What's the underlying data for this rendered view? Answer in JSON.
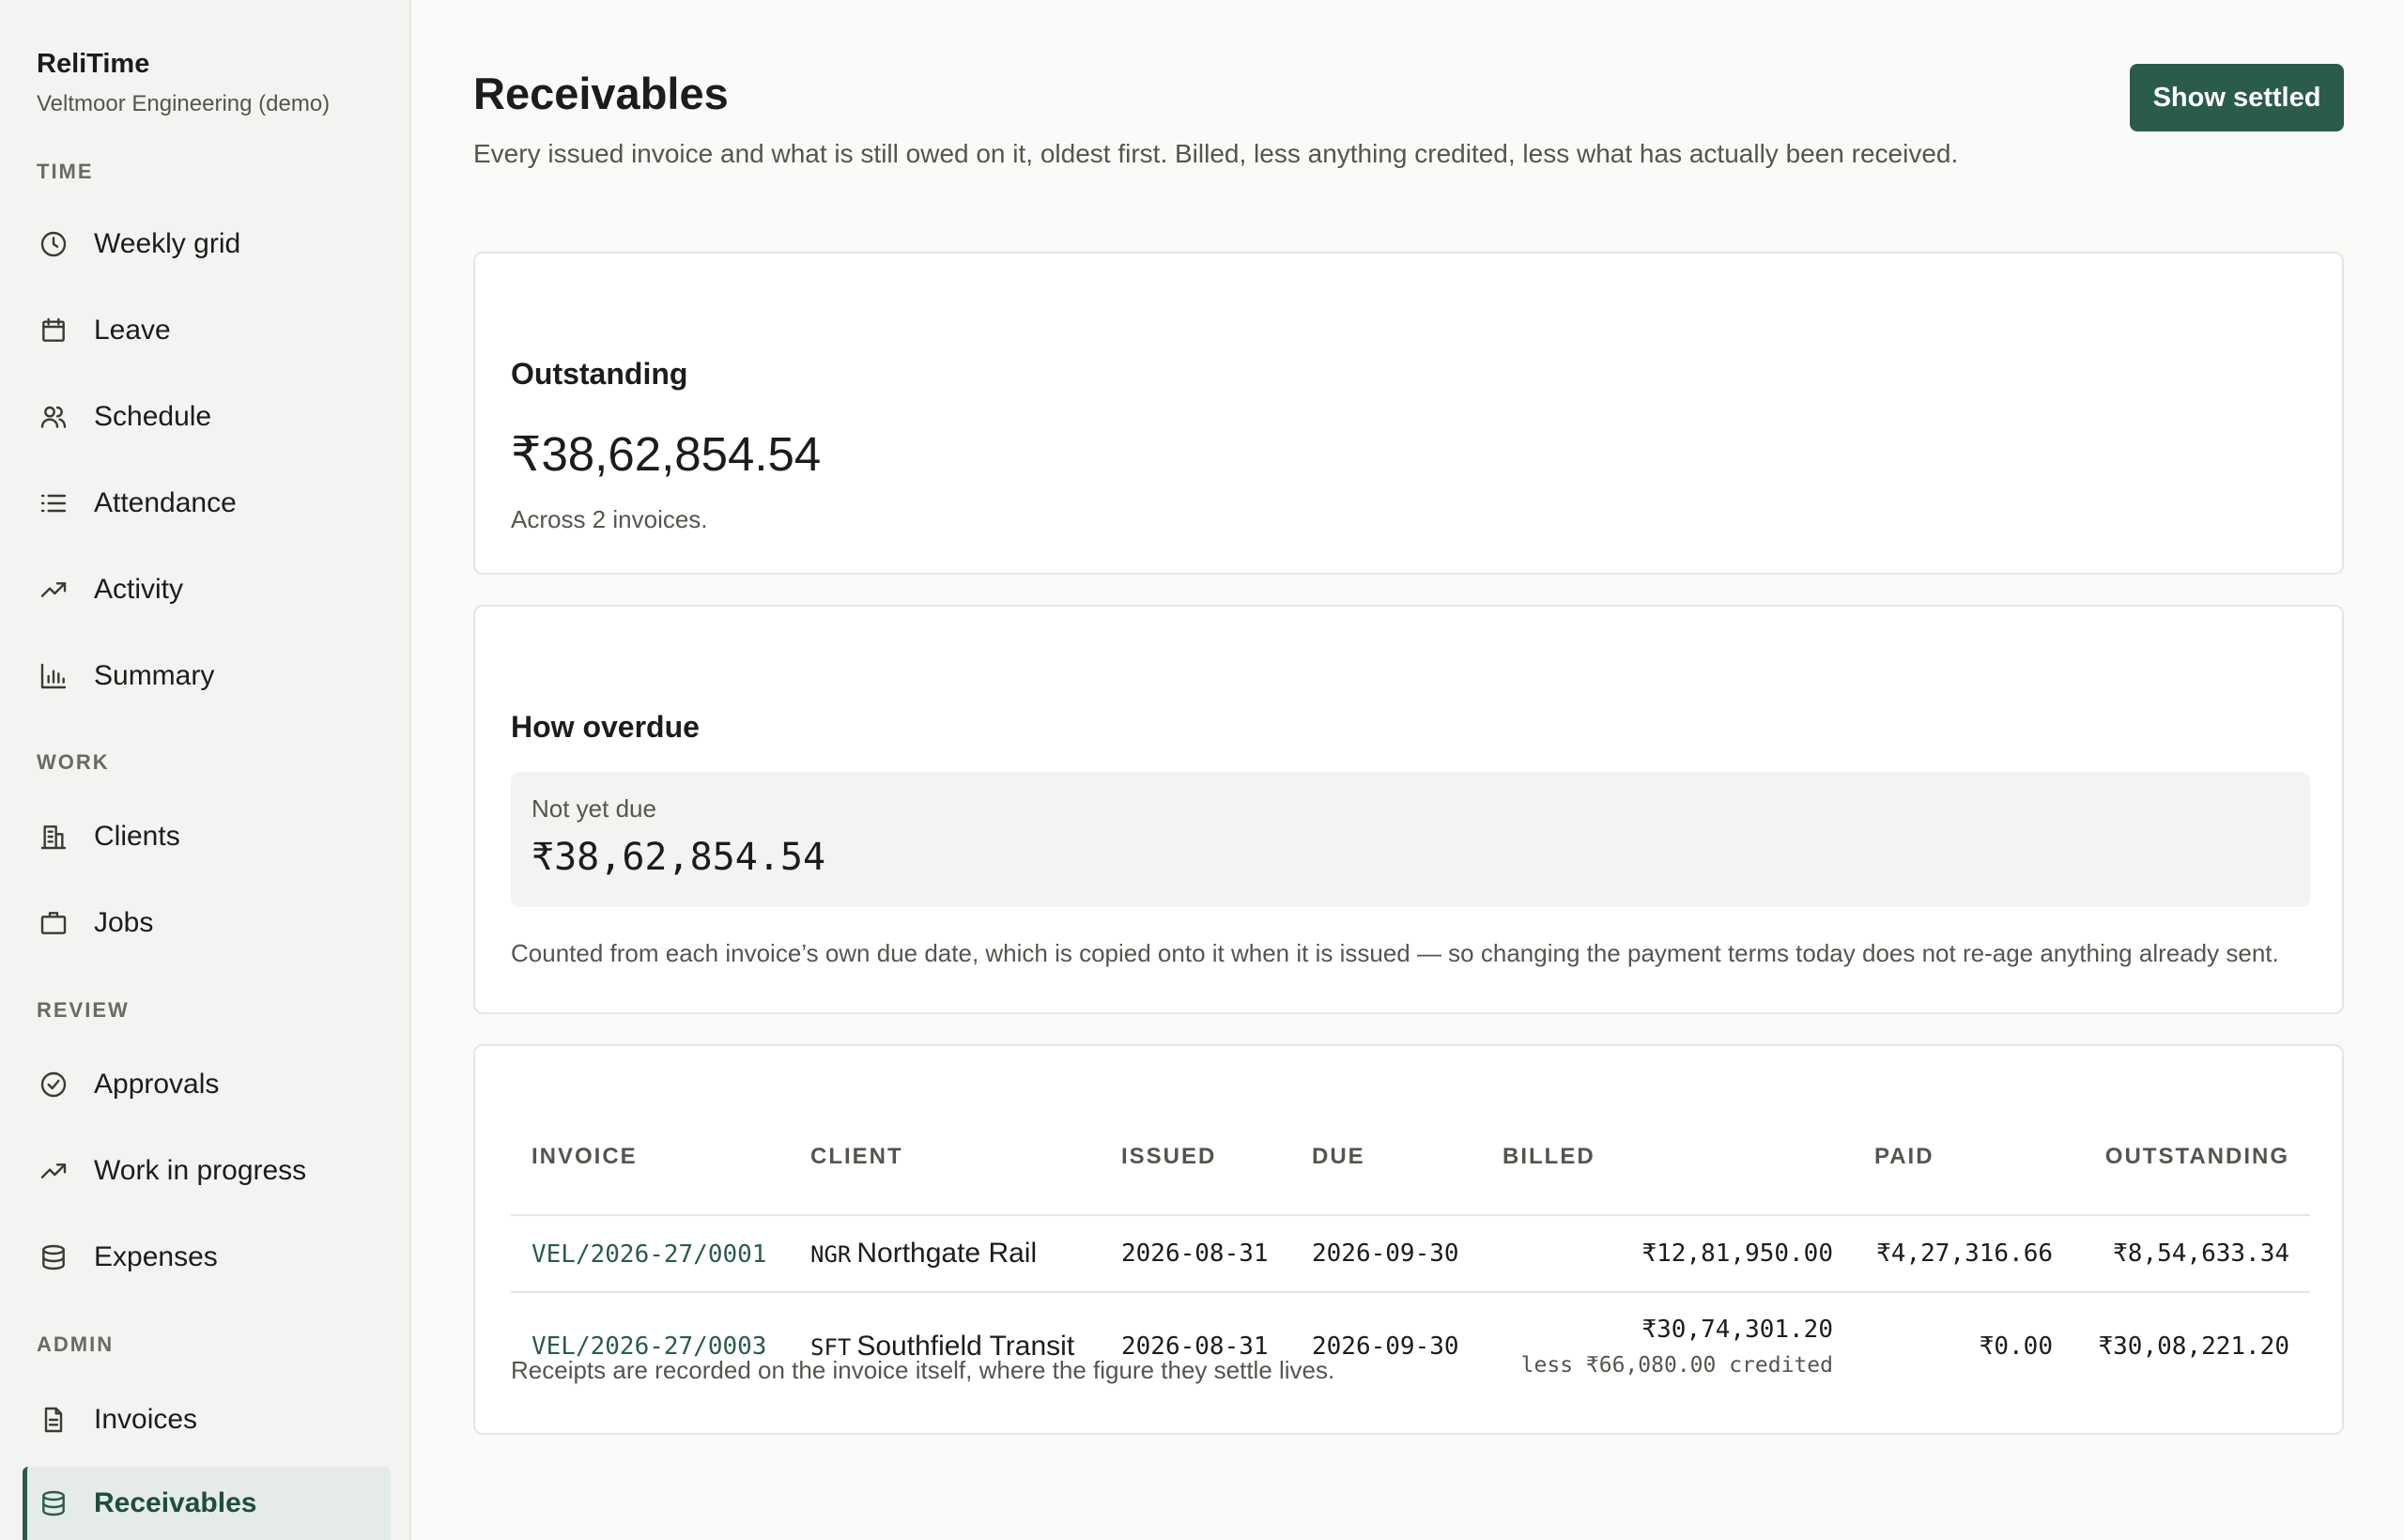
{
  "brand": {
    "name": "ReliTime",
    "org": "Veltmoor Engineering (demo)"
  },
  "nav": {
    "time_label": "TIME",
    "work_label": "WORK",
    "review_label": "REVIEW",
    "admin_label": "ADMIN",
    "items": [
      {
        "label": "Weekly grid",
        "icon": "clock-icon"
      },
      {
        "label": "Leave",
        "icon": "calendar-icon"
      },
      {
        "label": "Schedule",
        "icon": "users-icon"
      },
      {
        "label": "Attendance",
        "icon": "list-icon"
      },
      {
        "label": "Activity",
        "icon": "trending-icon"
      },
      {
        "label": "Summary",
        "icon": "bar-chart-icon"
      },
      {
        "label": "Clients",
        "icon": "building-icon"
      },
      {
        "label": "Jobs",
        "icon": "briefcase-icon"
      },
      {
        "label": "Approvals",
        "icon": "check-circle-icon"
      },
      {
        "label": "Work in progress",
        "icon": "trending-icon"
      },
      {
        "label": "Expenses",
        "icon": "database-icon"
      },
      {
        "label": "Invoices",
        "icon": "document-icon"
      },
      {
        "label": "Receivables",
        "icon": "database-icon",
        "active": true
      }
    ]
  },
  "header": {
    "title": "Receivables",
    "description": "Every issued invoice and what is still owed on it, oldest first. Billed, less anything credited, less what has actually been received.",
    "show_settled_label": "Show settled"
  },
  "outstanding": {
    "title": "Outstanding",
    "amount": "₹38,62,854.54",
    "note": "Across 2 invoices."
  },
  "overdue": {
    "title": "How overdue",
    "bucket_label": "Not yet due",
    "bucket_amount": "₹38,62,854.54",
    "note": "Counted from each invoice’s own due date, which is copied onto it when it is issued — so changing the payment terms today does not re-age anything already sent."
  },
  "table": {
    "columns": [
      "INVOICE",
      "CLIENT",
      "ISSUED",
      "DUE",
      "BILLED",
      "PAID",
      "OUTSTANDING"
    ],
    "rows": [
      {
        "invoice": "VEL/2026-27/0001",
        "client_code": "NGR",
        "client_name": "Northgate Rail",
        "issued": "2026-08-31",
        "due": "2026-09-30",
        "billed": "₹12,81,950.00",
        "credit_note": "",
        "paid": "₹4,27,316.66",
        "outstanding": "₹8,54,633.34"
      },
      {
        "invoice": "VEL/2026-27/0003",
        "client_code": "SFT",
        "client_name": "Southfield Transit",
        "issued": "2026-08-31",
        "due": "2026-09-30",
        "billed": "₹30,74,301.20",
        "credit_note": "less ₹66,080.00 credited",
        "paid": "₹0.00",
        "outstanding": "₹30,08,221.20"
      }
    ],
    "note": "Receipts are recorded on the invoice itself, where the figure they settle lives."
  },
  "colors": {
    "accent": "#2b5c4a",
    "active_bg": "#e5ece8",
    "page_bg": "#fafaf9",
    "sidebar_bg": "#f3f3f1"
  }
}
